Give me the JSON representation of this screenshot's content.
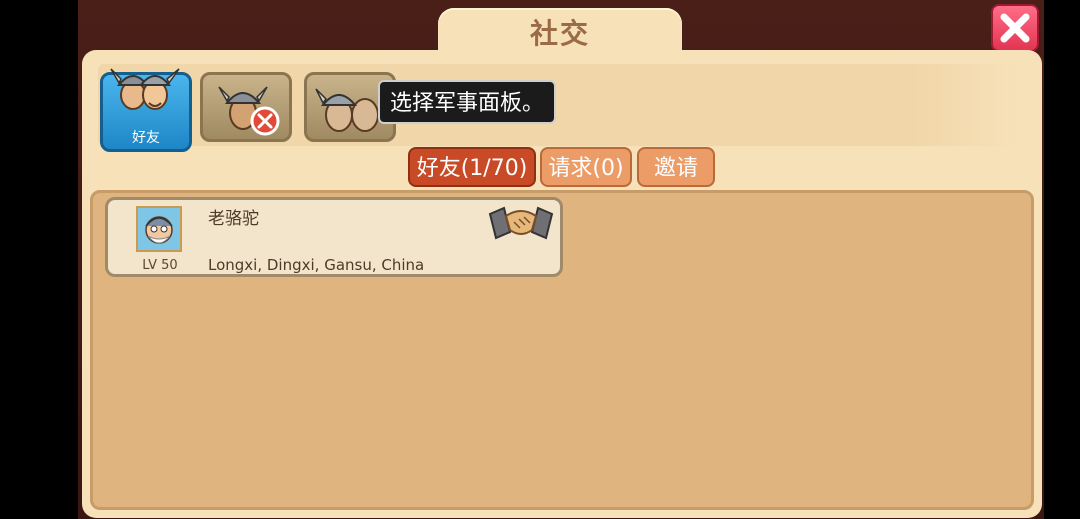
{
  "header": {
    "title": "社交",
    "close_icon": "close-x-icon"
  },
  "tabs": [
    {
      "label": "好友",
      "icon": "friends-vikings-icon",
      "active": true
    },
    {
      "label": "",
      "icon": "blocked-viking-icon",
      "active": false
    },
    {
      "label": "",
      "icon": "military-panel-icon",
      "active": false
    }
  ],
  "tooltip": "选择军事面板。",
  "subtabs": [
    {
      "label": "好友(1/70)",
      "active": true
    },
    {
      "label": "请求(0)",
      "active": false
    },
    {
      "label": "邀请",
      "active": false
    }
  ],
  "friends": [
    {
      "name": "老骆驼",
      "level": "LV 50",
      "location": "Longxi, Dingxi, Gansu, China",
      "action_icon": "handshake-icon"
    }
  ]
}
